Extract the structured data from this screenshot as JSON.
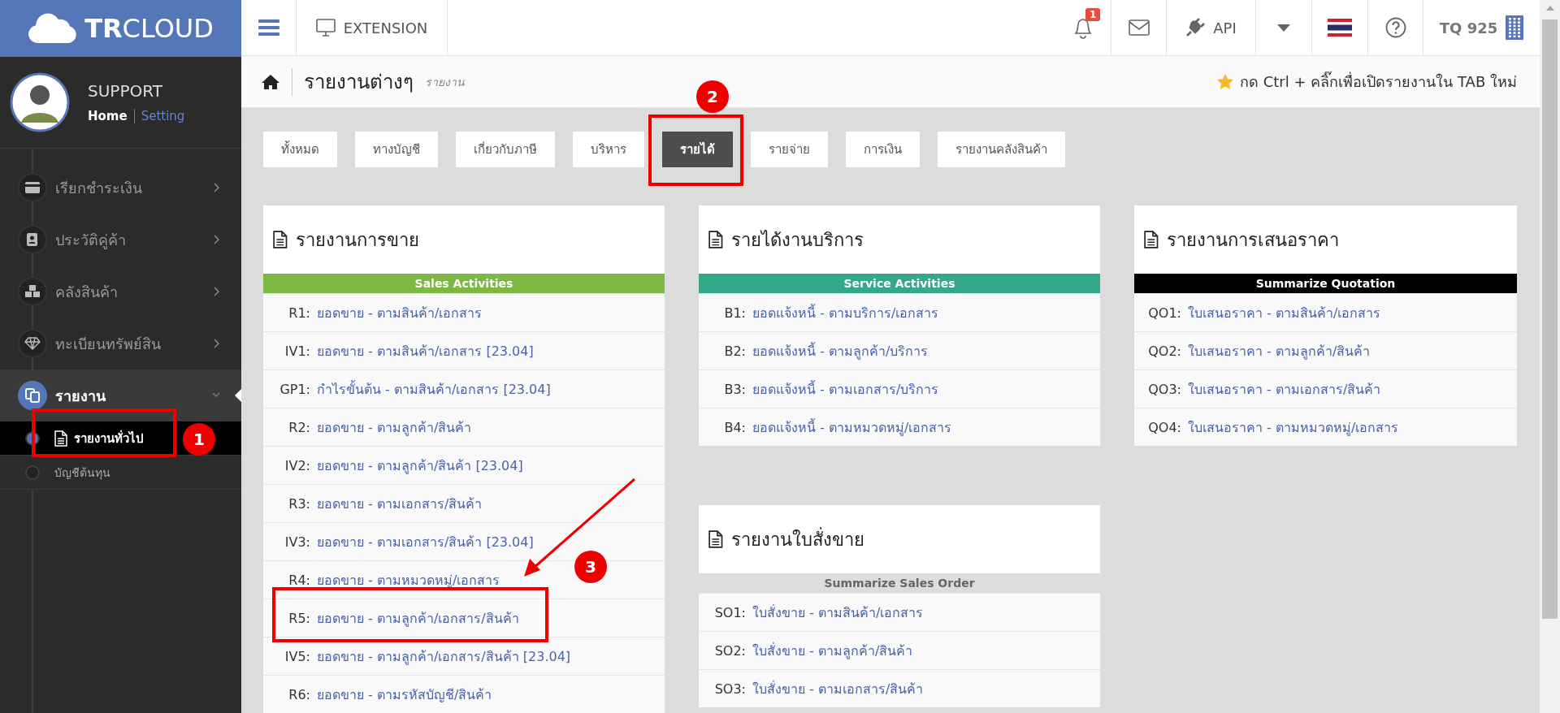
{
  "sidebar": {
    "brand": "**TR**CLOUD",
    "user": {
      "name": "SUPPORT",
      "links": [
        {
          "label": "Home",
          "selected": true
        },
        {
          "label": "Setting",
          "selected": false
        }
      ]
    },
    "menu": [
      {
        "label": "เรียกชำระเงิน",
        "kind": "card",
        "expanded": false
      },
      {
        "label": "ประวัติคู่ค้า",
        "kind": "contact",
        "expanded": false
      },
      {
        "label": "คลังสินค้า",
        "kind": "boxes",
        "expanded": false
      },
      {
        "label": "ทะเบียนทรัพย์สิน",
        "kind": "diamond",
        "expanded": false
      },
      {
        "label": "รายงาน",
        "kind": "report",
        "expanded": true,
        "children": [
          {
            "label": "รายงานทั่วไป",
            "selected": true,
            "callout": "1"
          },
          {
            "label": "บัญชีต้นทุน",
            "selected": false
          }
        ]
      }
    ]
  },
  "topbar": {
    "extension": "EXTENSION",
    "notifications": "1",
    "api": "API",
    "account": "TQ 925"
  },
  "header": {
    "title": "รายงานต่างๆ",
    "subtitle": "รายงาน",
    "hint": "กด Ctrl + คลิ๊กเพื่อเปิดรายงานใน TAB ใหม่"
  },
  "tabs": [
    {
      "label": "ทั้งหมด",
      "selected": false
    },
    {
      "label": "ทางบัญชี",
      "selected": false
    },
    {
      "label": "เกี่ยวกับภาษี",
      "selected": false
    },
    {
      "label": "บริหาร",
      "selected": false
    },
    {
      "label": "รายได้",
      "selected": true,
      "callout": "2"
    },
    {
      "label": "รายจ่าย",
      "selected": false
    },
    {
      "label": "การเงิน",
      "selected": false
    },
    {
      "label": "รายงานคลังสินค้า",
      "selected": false
    }
  ],
  "report_columns": [
    {
      "cards": [
        {
          "title": "รายงานการขาย",
          "section": "Sales Activities",
          "color": "#7db843",
          "rows": [
            {
              "code": "R1:",
              "name": "ยอดขาย - ตามสินค้า/เอกสาร"
            },
            {
              "code": "IV1:",
              "name": "ยอดขาย - ตามสินค้า/เอกสาร [23.04]"
            },
            {
              "code": "GP1:",
              "name": "กำไรขั้นต้น - ตามสินค้า/เอกสาร [23.04]"
            },
            {
              "code": "R2:",
              "name": "ยอดขาย - ตามลูกค้า/สินค้า"
            },
            {
              "code": "IV2:",
              "name": "ยอดขาย - ตามลูกค้า/สินค้า [23.04]"
            },
            {
              "code": "R3:",
              "name": "ยอดขาย - ตามเอกสาร/สินค้า"
            },
            {
              "code": "IV3:",
              "name": "ยอดขาย - ตามเอกสาร/สินค้า [23.04]"
            },
            {
              "code": "R4:",
              "name": "ยอดขาย - ตามหมวดหมู่/เอกสาร"
            },
            {
              "code": "R5:",
              "name": "ยอดขาย - ตามลูกค้า/เอกสาร/สินค้า",
              "callout": "3"
            },
            {
              "code": "IV5:",
              "name": "ยอดขาย - ตามลูกค้า/เอกสาร/สินค้า [23.04]"
            },
            {
              "code": "R6:",
              "name": "ยอดขาย - ตามรหัสบัญชี/สินค้า"
            }
          ]
        }
      ]
    },
    {
      "cards": [
        {
          "title": "รายได้งานบริการ",
          "section": "Service Activities",
          "color": "#33a98a",
          "rows": [
            {
              "code": "B1:",
              "name": "ยอดแจ้งหนี้ - ตามบริการ/เอกสาร"
            },
            {
              "code": "B2:",
              "name": "ยอดแจ้งหนี้ - ตามลูกค้า/บริการ"
            },
            {
              "code": "B3:",
              "name": "ยอดแจ้งหนี้ - ตามเอกสาร/บริการ"
            },
            {
              "code": "B4:",
              "name": "ยอดแจ้งหนี้ - ตามหมวดหมู่/เอกสาร"
            }
          ]
        },
        {
          "title": "รายงานใบสั่งขาย",
          "section": "Summarize Sales Order",
          "color": "#dcdcdc",
          "rows": [
            {
              "code": "SO1:",
              "name": "ใบสั่งขาย - ตามสินค้า/เอกสาร"
            },
            {
              "code": "SO2:",
              "name": "ใบสั่งขาย - ตามลูกค้า/สินค้า"
            },
            {
              "code": "SO3:",
              "name": "ใบสั่งขาย - ตามเอกสาร/สินค้า"
            }
          ]
        }
      ]
    },
    {
      "cards": [
        {
          "title": "รายงานการเสนอราคา",
          "section": "Summarize Quotation",
          "color": "#000000",
          "rows": [
            {
              "code": "QO1:",
              "name": "ใบเสนอราคา - ตามสินค้า/เอกสาร"
            },
            {
              "code": "QO2:",
              "name": "ใบเสนอราคา - ตามลูกค้า/สินค้า"
            },
            {
              "code": "QO3:",
              "name": "ใบเสนอราคา - ตามเอกสาร/สินค้า"
            },
            {
              "code": "QO4:",
              "name": "ใบเสนอราคา - ตามหมวดหมู่/เอกสาร"
            }
          ]
        }
      ]
    }
  ]
}
